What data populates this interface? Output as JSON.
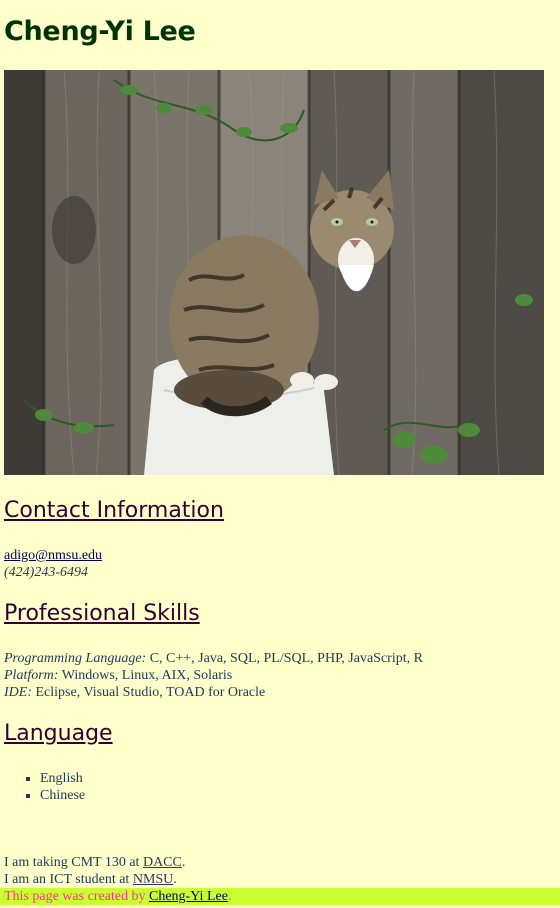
{
  "header": {
    "title": "Cheng-Yi Lee"
  },
  "photo": {
    "subject": "tabby-cat-on-fence"
  },
  "contact": {
    "heading": "Contact Information",
    "email": "adigo@nmsu.edu",
    "phone": "(424)243-6494"
  },
  "skills": {
    "heading": "Professional Skills",
    "programming_label": "Programming Language:",
    "programming_value": " C, C++, Java, SQL, PL/SQL, PHP, JavaScript, R",
    "platform_label": "Platform:",
    "platform_value": " Windows, Linux, AIX, Solaris",
    "ide_label": "IDE:",
    "ide_value": " Eclipse, Visual Studio, TOAD for Oracle"
  },
  "language": {
    "heading": "Language",
    "items": [
      "English",
      "Chinese"
    ]
  },
  "notes": {
    "cmt_prefix": "I am taking CMT 130 at ",
    "cmt_link": "DACC",
    "cmt_suffix": ".",
    "ict_prefix": "I am an ICT student at ",
    "ict_link": "NMSU",
    "ict_suffix": "."
  },
  "footer": {
    "credit": "This page was created by ",
    "author_link": "Cheng-Yi Lee",
    "suffix": "."
  },
  "colors": {
    "background": "#ffffcc",
    "footer_bar": "#ccff33",
    "credit_text": "#ff3399",
    "heading": "#330033"
  }
}
